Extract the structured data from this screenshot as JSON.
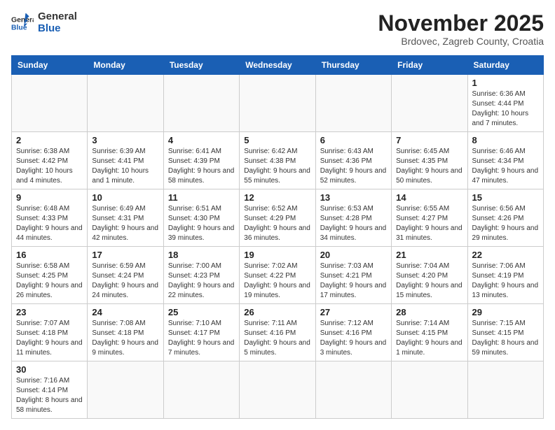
{
  "header": {
    "logo_general": "General",
    "logo_blue": "Blue",
    "month_title": "November 2025",
    "subtitle": "Brdovec, Zagreb County, Croatia"
  },
  "weekdays": [
    "Sunday",
    "Monday",
    "Tuesday",
    "Wednesday",
    "Thursday",
    "Friday",
    "Saturday"
  ],
  "weeks": [
    [
      {
        "day": "",
        "info": ""
      },
      {
        "day": "",
        "info": ""
      },
      {
        "day": "",
        "info": ""
      },
      {
        "day": "",
        "info": ""
      },
      {
        "day": "",
        "info": ""
      },
      {
        "day": "",
        "info": ""
      },
      {
        "day": "1",
        "info": "Sunrise: 6:36 AM\nSunset: 4:44 PM\nDaylight: 10 hours and 7 minutes."
      }
    ],
    [
      {
        "day": "2",
        "info": "Sunrise: 6:38 AM\nSunset: 4:42 PM\nDaylight: 10 hours and 4 minutes."
      },
      {
        "day": "3",
        "info": "Sunrise: 6:39 AM\nSunset: 4:41 PM\nDaylight: 10 hours and 1 minute."
      },
      {
        "day": "4",
        "info": "Sunrise: 6:41 AM\nSunset: 4:39 PM\nDaylight: 9 hours and 58 minutes."
      },
      {
        "day": "5",
        "info": "Sunrise: 6:42 AM\nSunset: 4:38 PM\nDaylight: 9 hours and 55 minutes."
      },
      {
        "day": "6",
        "info": "Sunrise: 6:43 AM\nSunset: 4:36 PM\nDaylight: 9 hours and 52 minutes."
      },
      {
        "day": "7",
        "info": "Sunrise: 6:45 AM\nSunset: 4:35 PM\nDaylight: 9 hours and 50 minutes."
      },
      {
        "day": "8",
        "info": "Sunrise: 6:46 AM\nSunset: 4:34 PM\nDaylight: 9 hours and 47 minutes."
      }
    ],
    [
      {
        "day": "9",
        "info": "Sunrise: 6:48 AM\nSunset: 4:33 PM\nDaylight: 9 hours and 44 minutes."
      },
      {
        "day": "10",
        "info": "Sunrise: 6:49 AM\nSunset: 4:31 PM\nDaylight: 9 hours and 42 minutes."
      },
      {
        "day": "11",
        "info": "Sunrise: 6:51 AM\nSunset: 4:30 PM\nDaylight: 9 hours and 39 minutes."
      },
      {
        "day": "12",
        "info": "Sunrise: 6:52 AM\nSunset: 4:29 PM\nDaylight: 9 hours and 36 minutes."
      },
      {
        "day": "13",
        "info": "Sunrise: 6:53 AM\nSunset: 4:28 PM\nDaylight: 9 hours and 34 minutes."
      },
      {
        "day": "14",
        "info": "Sunrise: 6:55 AM\nSunset: 4:27 PM\nDaylight: 9 hours and 31 minutes."
      },
      {
        "day": "15",
        "info": "Sunrise: 6:56 AM\nSunset: 4:26 PM\nDaylight: 9 hours and 29 minutes."
      }
    ],
    [
      {
        "day": "16",
        "info": "Sunrise: 6:58 AM\nSunset: 4:25 PM\nDaylight: 9 hours and 26 minutes."
      },
      {
        "day": "17",
        "info": "Sunrise: 6:59 AM\nSunset: 4:24 PM\nDaylight: 9 hours and 24 minutes."
      },
      {
        "day": "18",
        "info": "Sunrise: 7:00 AM\nSunset: 4:23 PM\nDaylight: 9 hours and 22 minutes."
      },
      {
        "day": "19",
        "info": "Sunrise: 7:02 AM\nSunset: 4:22 PM\nDaylight: 9 hours and 19 minutes."
      },
      {
        "day": "20",
        "info": "Sunrise: 7:03 AM\nSunset: 4:21 PM\nDaylight: 9 hours and 17 minutes."
      },
      {
        "day": "21",
        "info": "Sunrise: 7:04 AM\nSunset: 4:20 PM\nDaylight: 9 hours and 15 minutes."
      },
      {
        "day": "22",
        "info": "Sunrise: 7:06 AM\nSunset: 4:19 PM\nDaylight: 9 hours and 13 minutes."
      }
    ],
    [
      {
        "day": "23",
        "info": "Sunrise: 7:07 AM\nSunset: 4:18 PM\nDaylight: 9 hours and 11 minutes."
      },
      {
        "day": "24",
        "info": "Sunrise: 7:08 AM\nSunset: 4:18 PM\nDaylight: 9 hours and 9 minutes."
      },
      {
        "day": "25",
        "info": "Sunrise: 7:10 AM\nSunset: 4:17 PM\nDaylight: 9 hours and 7 minutes."
      },
      {
        "day": "26",
        "info": "Sunrise: 7:11 AM\nSunset: 4:16 PM\nDaylight: 9 hours and 5 minutes."
      },
      {
        "day": "27",
        "info": "Sunrise: 7:12 AM\nSunset: 4:16 PM\nDaylight: 9 hours and 3 minutes."
      },
      {
        "day": "28",
        "info": "Sunrise: 7:14 AM\nSunset: 4:15 PM\nDaylight: 9 hours and 1 minute."
      },
      {
        "day": "29",
        "info": "Sunrise: 7:15 AM\nSunset: 4:15 PM\nDaylight: 8 hours and 59 minutes."
      }
    ],
    [
      {
        "day": "30",
        "info": "Sunrise: 7:16 AM\nSunset: 4:14 PM\nDaylight: 8 hours and 58 minutes."
      },
      {
        "day": "",
        "info": ""
      },
      {
        "day": "",
        "info": ""
      },
      {
        "day": "",
        "info": ""
      },
      {
        "day": "",
        "info": ""
      },
      {
        "day": "",
        "info": ""
      },
      {
        "day": "",
        "info": ""
      }
    ]
  ]
}
